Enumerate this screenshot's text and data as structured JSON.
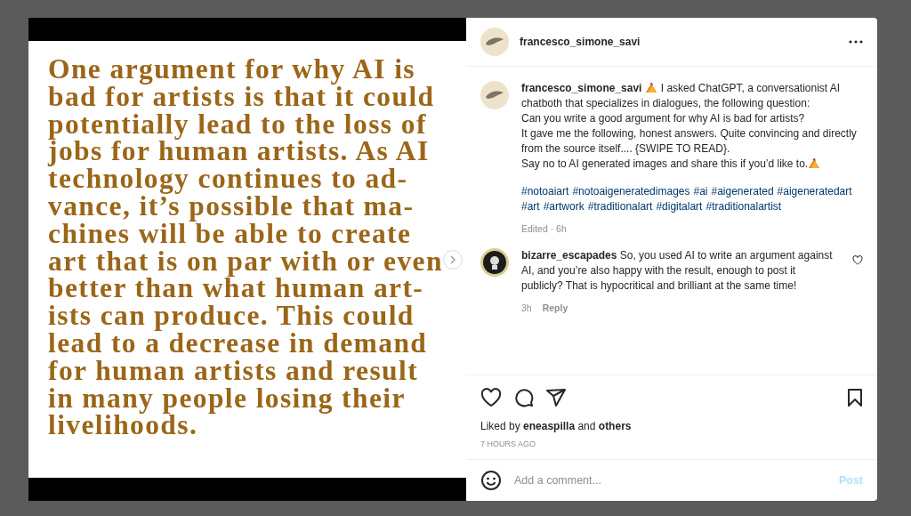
{
  "post_image": {
    "lines": [
      "One argument for why AI is",
      "bad for artists is that it could",
      "potentially lead to the loss of",
      "jobs for human artists. As AI",
      "technology continues to ad-",
      "vance, it’s possible that ma-",
      "chines will be able to create",
      "art that is on par with or even",
      "better than what human art-",
      "ists can produce. This could",
      "lead to a decrease in demand",
      "for human artists and result",
      "in many people losing their",
      "livelihoods."
    ]
  },
  "header": {
    "username": "francesco_simone_savi"
  },
  "caption": {
    "username": "francesco_simone_savi",
    "parts": [
      {
        "kind": "emoji"
      },
      {
        "kind": "text",
        "text": "I asked ChatGPT, a conversationist AI chatboth that specializes in dialogues, the following question:"
      },
      {
        "kind": "break"
      },
      {
        "kind": "text",
        "text": "Can you write a good argument for why AI is bad for artists?"
      },
      {
        "kind": "break"
      },
      {
        "kind": "text",
        "text": "It gave me the following, honest answers. Quite convincing and directly from the source itself.... {SWIPE TO READ}."
      },
      {
        "kind": "break"
      },
      {
        "kind": "text",
        "text": "Say no to AI generated images and share this if you’d like to."
      },
      {
        "kind": "emoji"
      }
    ],
    "hashtags": [
      "#notoaiart",
      "#notoaigeneratedimages",
      "#ai",
      "#aigenerated",
      "#aigeneratedart",
      "#art",
      "#artwork",
      "#traditionalart",
      "#digitalart",
      "#traditionalartist"
    ],
    "meta": "Edited · 6h"
  },
  "comments": [
    {
      "username": "bizarre_escapades",
      "text": "So, you used AI to write an argument against AI, and you’re also happy with the result, enough to post it publicly? That is hypocritical and brilliant at the same time!",
      "time": "3h",
      "reply": "Reply",
      "liked": false
    }
  ],
  "likes": {
    "prefix": "Liked by",
    "user": "eneaspilla",
    "and": "and",
    "others": "others"
  },
  "timestamp": "7 HOURS AGO",
  "comment_box": {
    "placeholder": "Add a comment...",
    "post": "Post",
    "disabled": true
  }
}
